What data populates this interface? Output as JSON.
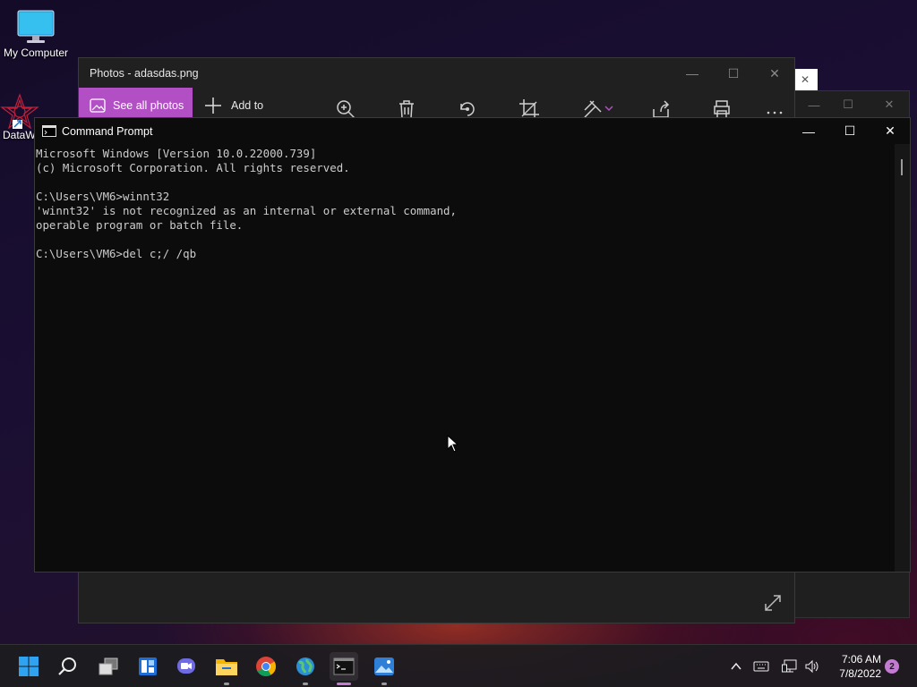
{
  "desktop": {
    "icons": [
      {
        "label": "My Computer"
      },
      {
        "label": "DataW"
      }
    ]
  },
  "photos_window": {
    "title": "Photos - adasdas.png",
    "see_all_label": "See all photos",
    "add_to_label": "Add to",
    "accent_color": "#b34fc4"
  },
  "background_window": {
    "partial_close_label": "✕"
  },
  "cmd_window": {
    "title": "Command Prompt",
    "lines": [
      "Microsoft Windows [Version 10.0.22000.739]",
      "(c) Microsoft Corporation. All rights reserved.",
      "",
      "C:\\Users\\VM6>winnt32",
      "'winnt32' is not recognized as an internal or external command,",
      "operable program or batch file.",
      "",
      "C:\\Users\\VM6>del c;/ /qb"
    ]
  },
  "taskbar": {
    "apps": [
      "start-icon",
      "search-icon",
      "task-view-icon",
      "widgets-icon",
      "chat-icon",
      "file-explorer-icon",
      "chrome-icon",
      "globe-icon",
      "terminal-icon",
      "photos-icon"
    ],
    "time": "7:06 AM",
    "date": "7/8/2022",
    "notification_count": "2"
  }
}
